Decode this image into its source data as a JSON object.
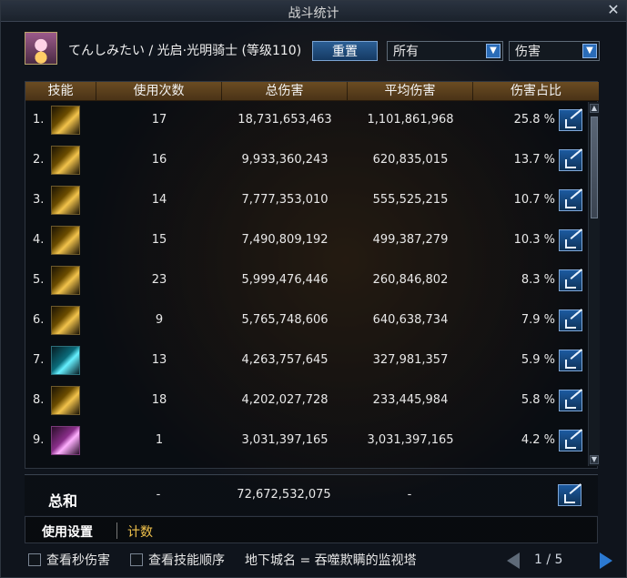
{
  "window": {
    "title": "战斗统计",
    "close_symbol": "✕"
  },
  "header": {
    "character_info": "てんしみたい / 光启·光明骑士 (等级110)",
    "reset_label": "重置",
    "filter_selected": "所有",
    "metric_selected": "伤害"
  },
  "table": {
    "columns": [
      "技能",
      "使用次数",
      "总伤害",
      "平均伤害",
      "伤害占比"
    ],
    "rows": [
      {
        "index": "1.",
        "uses": "17",
        "total": "18,731,653,463",
        "avg": "1,101,861,968",
        "pct": "25.8 %"
      },
      {
        "index": "2.",
        "uses": "16",
        "total": "9,933,360,243",
        "avg": "620,835,015",
        "pct": "13.7 %"
      },
      {
        "index": "3.",
        "uses": "14",
        "total": "7,777,353,010",
        "avg": "555,525,215",
        "pct": "10.7 %"
      },
      {
        "index": "4.",
        "uses": "15",
        "total": "7,490,809,192",
        "avg": "499,387,279",
        "pct": "10.3 %"
      },
      {
        "index": "5.",
        "uses": "23",
        "total": "5,999,476,446",
        "avg": "260,846,802",
        "pct": "8.3 %"
      },
      {
        "index": "6.",
        "uses": "9",
        "total": "5,765,748,606",
        "avg": "640,638,734",
        "pct": "7.9 %"
      },
      {
        "index": "7.",
        "uses": "13",
        "total": "4,263,757,645",
        "avg": "327,981,357",
        "pct": "5.9 %"
      },
      {
        "index": "8.",
        "uses": "18",
        "total": "4,202,027,728",
        "avg": "233,445,984",
        "pct": "5.8 %"
      },
      {
        "index": "9.",
        "uses": "1",
        "total": "3,031,397,165",
        "avg": "3,031,397,165",
        "pct": "4.2 %"
      }
    ],
    "sum": {
      "label": "总和",
      "uses": "-",
      "total": "72,672,532,075",
      "avg": "-"
    }
  },
  "tabs": {
    "settings": "使用设置",
    "counter": "计数"
  },
  "footer": {
    "checkbox_dps": "查看秒伤害",
    "checkbox_skill_order": "查看技能顺序",
    "dungeon": "地下城名 = 吞噬欺瞒的监视塔",
    "page": "1 / 5"
  }
}
